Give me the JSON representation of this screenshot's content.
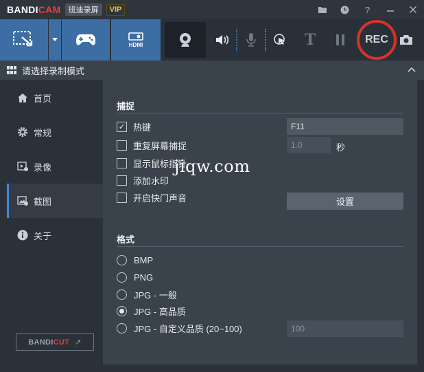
{
  "app": {
    "logo_main": "BANDI",
    "logo_accent": "CAM",
    "cn_name": "班迪录屏",
    "vip": "VIP"
  },
  "titlebar": {
    "icons": [
      "folder-icon",
      "clock-icon",
      "help-icon",
      "minimize-icon",
      "close-icon"
    ],
    "help_glyph": "?"
  },
  "toolbar": {
    "hdmi_label": "HDMI",
    "rec_label": "REC",
    "text_glyph": "T"
  },
  "modebar": {
    "label": "请选择录制模式"
  },
  "sidebar": {
    "items": [
      {
        "label": "首页",
        "icon": "home-icon"
      },
      {
        "label": "常规",
        "icon": "gear-icon"
      },
      {
        "label": "录像",
        "icon": "video-settings-icon"
      },
      {
        "label": "截图",
        "icon": "screenshot-settings-icon",
        "active": true
      },
      {
        "label": "关于",
        "icon": "info-icon"
      }
    ],
    "bandicut_main": "BANDI",
    "bandicut_accent": "CUT",
    "bandicut_arrow": "↗"
  },
  "capture": {
    "title": "捕捉",
    "hotkey_label": "热键",
    "hotkey_value": "F11",
    "repeat_label": "重复屏幕捕捉",
    "repeat_value": "1.0",
    "repeat_unit": "秒",
    "cursor_label": "显示鼠标指针",
    "watermark_label": "添加水印",
    "shutter_label": "开启快门声音",
    "settings_button": "设置"
  },
  "format": {
    "title": "格式",
    "options": [
      "BMP",
      "PNG",
      "JPG - 一般",
      "JPG - 高品质",
      "JPG - 自定义品质 (20~100)"
    ],
    "selected": "JPG - 高品质",
    "custom_quality_value": "100"
  },
  "overlay": {
    "watermark_text": "jiqw.com"
  },
  "colors": {
    "accent_blue": "#3d6ea3",
    "rec_red": "#d9322c",
    "vip_gold": "#f2c230"
  }
}
